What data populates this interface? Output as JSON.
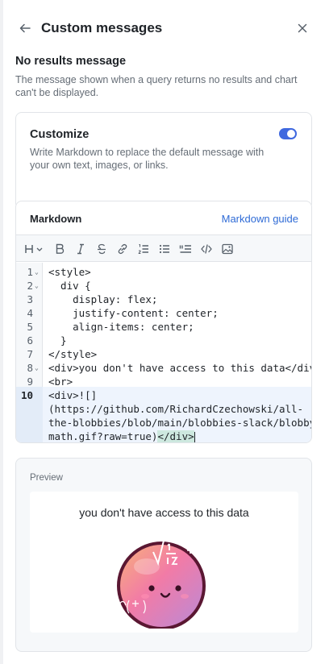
{
  "header": {
    "title": "Custom messages"
  },
  "section": {
    "title": "No results message",
    "description": "The message shown when a query returns no results and chart can't be displayed."
  },
  "customize": {
    "title": "Customize",
    "description": "Write Markdown to replace the default message with your own text, images, or links.",
    "enabled": true
  },
  "editor": {
    "label": "Markdown",
    "guide_link": "Markdown guide",
    "toolbar": [
      "heading-icon",
      "bold-icon",
      "italic-icon",
      "strikethrough-icon",
      "link-icon",
      "ordered-list-icon",
      "bullet-list-icon",
      "quote-icon",
      "code-icon",
      "image-icon"
    ],
    "lines": [
      {
        "n": "1",
        "fold": true,
        "text": "<style>"
      },
      {
        "n": "2",
        "fold": true,
        "text": "  div {"
      },
      {
        "n": "3",
        "fold": false,
        "text": "    display: flex;"
      },
      {
        "n": "4",
        "fold": false,
        "text": "    justify-content: center;"
      },
      {
        "n": "5",
        "fold": false,
        "text": "    align-items: center;"
      },
      {
        "n": "6",
        "fold": false,
        "text": "  }"
      },
      {
        "n": "7",
        "fold": false,
        "text": "</style>"
      },
      {
        "n": "8",
        "fold": true,
        "text": "<div>you don't have access to this data</div>"
      },
      {
        "n": "9",
        "fold": false,
        "text": "<br>"
      },
      {
        "n": "10",
        "fold": false,
        "text": "<div>![]"
      }
    ],
    "wrapped": [
      "(https://github.com/RichardCzechowski/all-",
      "the-blobbies/blob/main/blobbies-slack/blobby-",
      "math.gif?raw=true)"
    ],
    "closing_tag": "</div>"
  },
  "preview": {
    "label": "Preview",
    "text": "you don't have access to this data",
    "image_alt": "blobby-math"
  },
  "colors": {
    "accent": "#3f68df",
    "link": "#2f6bd6",
    "tag_highlight": "#cde8df"
  }
}
